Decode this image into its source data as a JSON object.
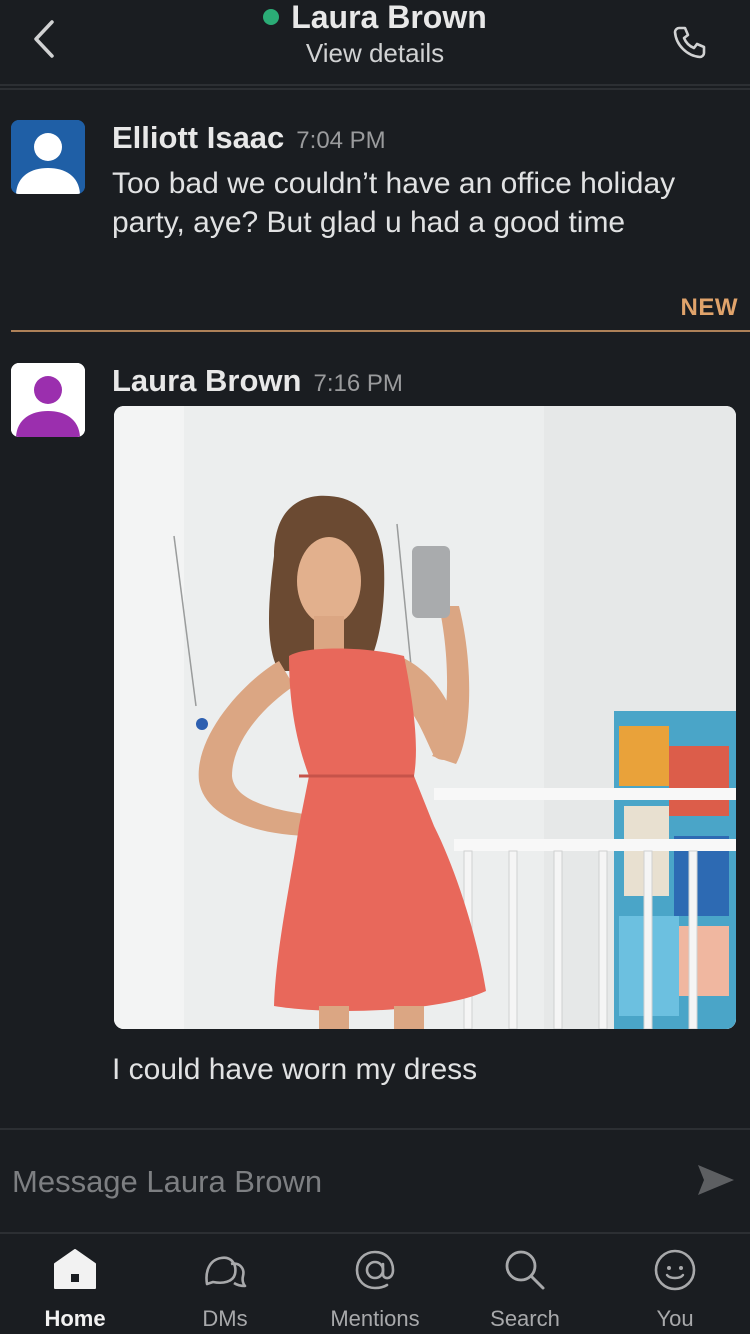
{
  "header": {
    "title": "Laura Brown",
    "subtitle": "View details",
    "presence_color": "#2bac76",
    "back_icon": "chevron-left-icon",
    "call_icon": "phone-icon"
  },
  "messages": [
    {
      "sender": "Elliott Isaac",
      "time": "7:04 PM",
      "text": "Too bad we couldn’t have an office holiday party, aye? But glad u had a good time",
      "avatar_color": "#1f5fa6"
    },
    {
      "sender": "Laura Brown",
      "time": "7:16 PM",
      "text": "I could have worn my dress",
      "avatar_color": "#9b2fae"
    }
  ],
  "new_divider": {
    "label": "NEW",
    "color": "#e0a36b"
  },
  "composer": {
    "placeholder": "Message Laura Brown",
    "send_icon": "send-icon"
  },
  "tabbar": {
    "tabs": [
      {
        "label": "Home",
        "icon": "home-icon",
        "active": true
      },
      {
        "label": "DMs",
        "icon": "dms-icon",
        "active": false
      },
      {
        "label": "Mentions",
        "icon": "at-icon",
        "active": false
      },
      {
        "label": "Search",
        "icon": "search-icon",
        "active": false
      },
      {
        "label": "You",
        "icon": "you-icon",
        "active": false
      }
    ]
  }
}
